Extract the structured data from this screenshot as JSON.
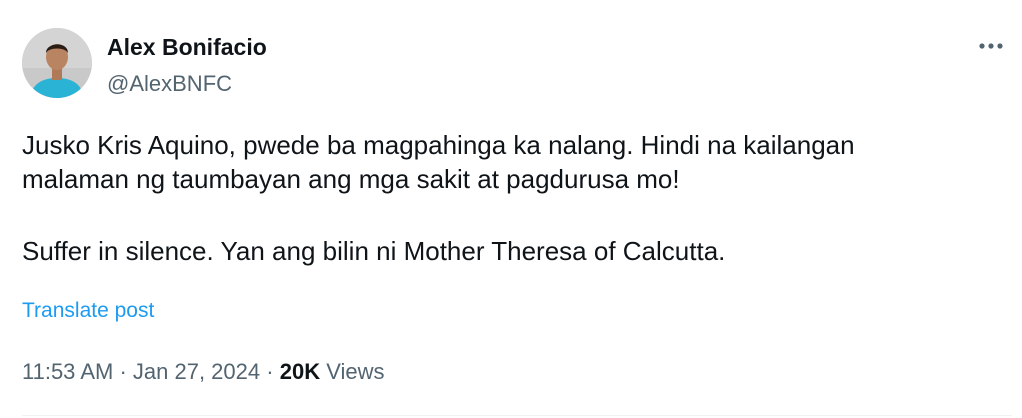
{
  "author": {
    "name": "Alex Bonifacio",
    "handle": "@AlexBNFC",
    "avatar_icon": "person-avatar-icon"
  },
  "more_icon": "more-horizontal-icon",
  "post": {
    "paragraphs": [
      "Jusko Kris Aquino, pwede ba magpahinga ka nalang. Hindi na kailangan",
      "malaman ng taumbayan ang mga sakit at pagdurusa mo!",
      "Suffer in silence. Yan ang bilin ni Mother Theresa of Calcutta."
    ],
    "translate_label": "Translate post"
  },
  "meta": {
    "time": "11:53 AM",
    "separator": "·",
    "date": "Jan 27, 2024",
    "views_count": "20K",
    "views_label": "Views"
  },
  "colors": {
    "text": "#0f1419",
    "secondary": "#536471",
    "link": "#1d9bf0",
    "avatar_bg": "#c9c9c9",
    "shirt": "#2bb3d6"
  }
}
